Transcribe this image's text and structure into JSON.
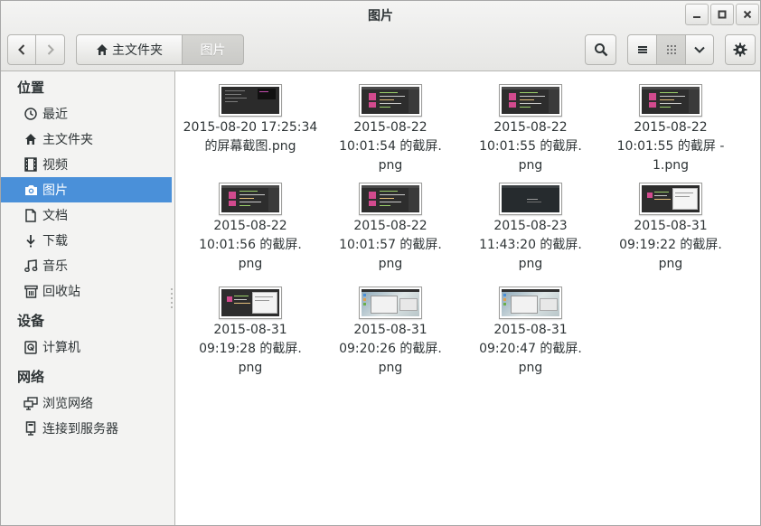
{
  "window": {
    "title": "图片"
  },
  "toolbar": {
    "breadcrumb_home": "主文件夹",
    "breadcrumb_current": "图片"
  },
  "sidebar": {
    "sections": [
      {
        "title": "位置",
        "items": [
          {
            "label": "最近",
            "icon": "clock-icon"
          },
          {
            "label": "主文件夹",
            "icon": "home-icon"
          },
          {
            "label": "视频",
            "icon": "film-icon"
          },
          {
            "label": "图片",
            "icon": "camera-icon",
            "active": true
          },
          {
            "label": "文档",
            "icon": "document-icon"
          },
          {
            "label": "下载",
            "icon": "download-icon"
          },
          {
            "label": "音乐",
            "icon": "music-icon"
          },
          {
            "label": "回收站",
            "icon": "trash-icon"
          }
        ]
      },
      {
        "title": "设备",
        "items": [
          {
            "label": "计算机",
            "icon": "computer-icon"
          }
        ]
      },
      {
        "title": "网络",
        "items": [
          {
            "label": "浏览网络",
            "icon": "network-icon"
          },
          {
            "label": "连接到服务器",
            "icon": "server-icon"
          }
        ]
      }
    ]
  },
  "files": [
    {
      "name": "2015-08-20 17:25:34\n的屏幕截图.png",
      "thumb": "dark-editor"
    },
    {
      "name": "2015-08-22\n10:01:54 的截屏.\npng",
      "thumb": "editor-pink"
    },
    {
      "name": "2015-08-22\n10:01:55 的截屏.\npng",
      "thumb": "editor-pink"
    },
    {
      "name": "2015-08-22\n10:01:55 的截屏 -\n1.png",
      "thumb": "editor-pink"
    },
    {
      "name": "2015-08-22\n10:01:56 的截屏.\npng",
      "thumb": "editor-pink"
    },
    {
      "name": "2015-08-22\n10:01:57 的截屏.\npng",
      "thumb": "editor-pink"
    },
    {
      "name": "2015-08-23\n11:43:20 的截屏.\npng",
      "thumb": "dark-plain"
    },
    {
      "name": "2015-08-31\n09:19:22 的截屏.\npng",
      "thumb": "editor-window"
    },
    {
      "name": "2015-08-31\n09:19:28 的截屏.\npng",
      "thumb": "editor-window"
    },
    {
      "name": "2015-08-31\n09:20:26 的截屏.\npng",
      "thumb": "desktop"
    },
    {
      "name": "2015-08-31\n09:20:47 的截屏.\npng",
      "thumb": "desktop"
    }
  ]
}
